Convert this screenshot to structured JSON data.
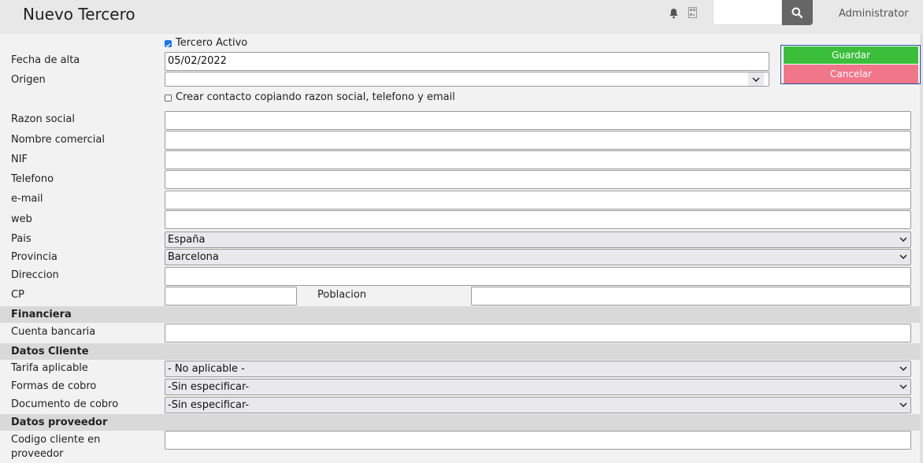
{
  "header": {
    "title": "Nuevo Tercero",
    "search_placeholder": "",
    "user": "Administrator"
  },
  "form": {
    "active_label": "Tercero Activo",
    "active_checked": true,
    "fecha_label": "Fecha de alta",
    "fecha_value": "05/02/2022",
    "origen_label": "Origen",
    "origen_value": "",
    "crear_contacto_label": "Crear contacto copiando razon social, telefono y email",
    "crear_contacto_checked": false,
    "razon_label": "Razon social",
    "nombre_label": "Nombre comercial",
    "nif_label": "NIF",
    "telefono_label": "Telefono",
    "email_label": "e-mail",
    "web_label": "web",
    "pais_label": "Pais",
    "pais_value": "España",
    "provincia_label": "Provincia",
    "provincia_value": "Barcelona",
    "direccion_label": "Direccion",
    "cp_label": "CP",
    "poblacion_label": "Poblacion"
  },
  "actions": {
    "save": "Guardar",
    "cancel": "Cancelar"
  },
  "financiera": {
    "heading": "Financiera",
    "cuenta_label": "Cuenta bancaria"
  },
  "cliente": {
    "heading": "Datos Cliente",
    "tarifa_label": "Tarifa aplicable",
    "tarifa_value": "- No aplicable -",
    "formas_label": "Formas de cobro",
    "formas_value": "-Sin especificar-",
    "documento_label": "Documento de cobro",
    "documento_value": "-Sin especificar-"
  },
  "proveedor": {
    "heading": "Datos proveedor",
    "codigo_label": "Codigo cliente en proveedor"
  },
  "colors": {
    "save": "#3bbf3b",
    "cancel": "#f2768a",
    "section_bg": "#d9d9d9",
    "search_button": "#666666"
  }
}
